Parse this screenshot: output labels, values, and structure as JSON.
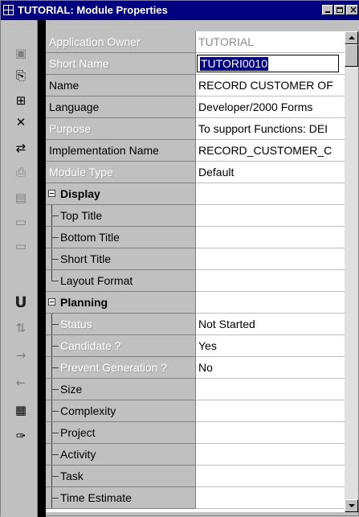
{
  "window": {
    "title": "TUTORIAL: Module Properties"
  },
  "toolbar": {
    "tools": [
      {
        "icon": "save-icon",
        "glyph": "▣"
      },
      {
        "icon": "copy-properties-icon",
        "glyph": "⎘"
      },
      {
        "icon": "add-child-icon",
        "glyph": "⊞"
      },
      {
        "icon": "delete-icon",
        "glyph": "✕"
      },
      {
        "icon": "move-icon",
        "glyph": "⇄"
      },
      {
        "icon": "print-icon",
        "glyph": "⎙"
      },
      {
        "icon": "report-icon",
        "glyph": "▤"
      },
      {
        "icon": "ascii-export-icon",
        "glyph": "▭"
      },
      {
        "icon": "html-export-icon",
        "glyph": "▭"
      },
      {
        "icon": "union-icon",
        "glyph": "U"
      },
      {
        "icon": "sort-icon",
        "glyph": "⇅"
      },
      {
        "icon": "move-right-icon",
        "glyph": "→"
      },
      {
        "icon": "move-left-icon",
        "glyph": "←"
      },
      {
        "icon": "table-icon",
        "glyph": "▦"
      },
      {
        "icon": "pin-icon",
        "glyph": "✑"
      }
    ]
  },
  "properties": [
    {
      "name": "Application Owner",
      "value": "TUTORIAL"
    },
    {
      "name": "Short Name",
      "value": "TUTORI0010"
    },
    {
      "name": "Name",
      "value": "RECORD CUSTOMER OF"
    },
    {
      "name": "Language",
      "value": "Developer/2000 Forms"
    },
    {
      "name": "Purpose",
      "value": "To support Functions: DEI"
    },
    {
      "name": "Implementation Name",
      "value": "RECORD_CUSTOMER_C"
    },
    {
      "name": "Module Type",
      "value": "Default"
    },
    {
      "name": "Display",
      "value": ""
    },
    {
      "name": "Top Title",
      "value": ""
    },
    {
      "name": "Bottom Title",
      "value": ""
    },
    {
      "name": "Short Title",
      "value": ""
    },
    {
      "name": "Layout Format",
      "value": ""
    },
    {
      "name": "Planning",
      "value": ""
    },
    {
      "name": "Status",
      "value": "Not Started"
    },
    {
      "name": "Candidate ?",
      "value": "Yes"
    },
    {
      "name": "Prevent Generation ?",
      "value": "No"
    },
    {
      "name": "Size",
      "value": ""
    },
    {
      "name": "Complexity",
      "value": ""
    },
    {
      "name": "Project",
      "value": ""
    },
    {
      "name": "Activity",
      "value": ""
    },
    {
      "name": "Task",
      "value": ""
    },
    {
      "name": "Time Estimate",
      "value": ""
    }
  ]
}
